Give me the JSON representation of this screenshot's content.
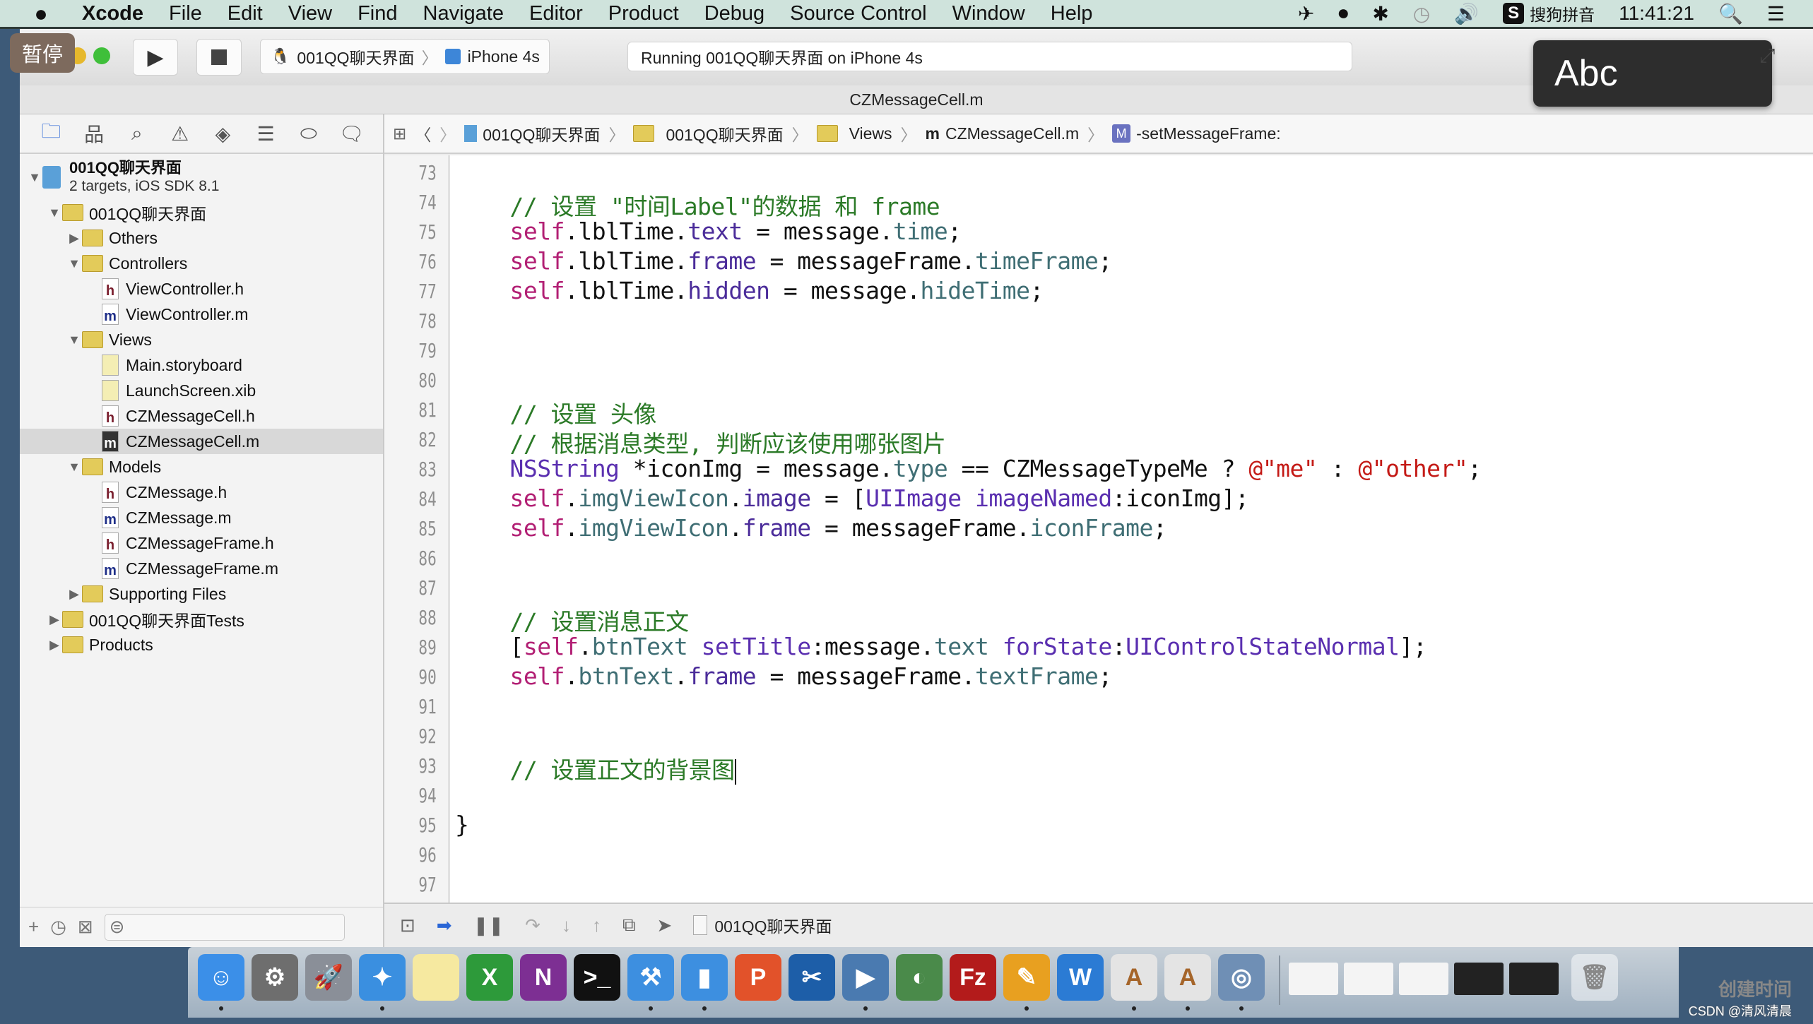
{
  "menubar": {
    "apple": "",
    "app_name": "Xcode",
    "items": [
      "File",
      "Edit",
      "View",
      "Find",
      "Navigate",
      "Editor",
      "Product",
      "Debug",
      "Source Control",
      "Window",
      "Help"
    ],
    "input_method": "搜狗拼音",
    "input_method_badge": "S",
    "clock": "11:41:21"
  },
  "toolbar": {
    "pause_badge": "暂停",
    "scheme": "001QQ聊天界面",
    "device": "iPhone 4s",
    "activity": "Running 001QQ聊天界面 on iPhone 4s",
    "ime_hud": "Abc"
  },
  "tab_title": "CZMessageCell.m",
  "navigator": {
    "project": {
      "name": "001QQ聊天界面",
      "subtitle": "2 targets, iOS SDK 8.1"
    },
    "tree": [
      {
        "label": "001QQ聊天界面",
        "type": "folder",
        "level": 1,
        "open": true
      },
      {
        "label": "Others",
        "type": "folder",
        "level": 2,
        "open": false
      },
      {
        "label": "Controllers",
        "type": "folder",
        "level": 2,
        "open": true
      },
      {
        "label": "ViewController.h",
        "type": "h",
        "level": 3
      },
      {
        "label": "ViewController.m",
        "type": "m",
        "level": 3
      },
      {
        "label": "Views",
        "type": "folder",
        "level": 2,
        "open": true
      },
      {
        "label": "Main.storyboard",
        "type": "sb",
        "level": 3
      },
      {
        "label": "LaunchScreen.xib",
        "type": "xib",
        "level": 3
      },
      {
        "label": "CZMessageCell.h",
        "type": "h",
        "level": 3
      },
      {
        "label": "CZMessageCell.m",
        "type": "m",
        "level": 3,
        "selected": true
      },
      {
        "label": "Models",
        "type": "folder",
        "level": 2,
        "open": true
      },
      {
        "label": "CZMessage.h",
        "type": "h",
        "level": 3
      },
      {
        "label": "CZMessage.m",
        "type": "m",
        "level": 3
      },
      {
        "label": "CZMessageFrame.h",
        "type": "h",
        "level": 3
      },
      {
        "label": "CZMessageFrame.m",
        "type": "m",
        "level": 3
      },
      {
        "label": "Supporting Files",
        "type": "folder",
        "level": 2,
        "open": false
      },
      {
        "label": "001QQ聊天界面Tests",
        "type": "folder",
        "level": 1,
        "open": false
      },
      {
        "label": "Products",
        "type": "folder",
        "level": 1,
        "open": false
      }
    ],
    "tabs": [
      "project-navigator-icon",
      "symbol-navigator-icon",
      "find-navigator-icon",
      "issue-navigator-icon",
      "test-navigator-icon",
      "debug-navigator-icon",
      "breakpoint-navigator-icon",
      "report-navigator-icon"
    ]
  },
  "jumpbar": {
    "crumbs": [
      "001QQ聊天界面",
      "001QQ聊天界面",
      "Views",
      "CZMessageCell.m",
      "-setMessageFrame:"
    ],
    "method_badge": "M"
  },
  "editor": {
    "lines": [
      {
        "n": "73",
        "html": ""
      },
      {
        "n": "74",
        "html": "    <span class='c-com'>// 设置 \"时间Label\"的数据 和 frame</span>"
      },
      {
        "n": "75",
        "html": "    <span class='c-kw'>self</span>.lblTime.<span class='c-prop'>text</span> = message.<span class='c-mem'>time</span>;"
      },
      {
        "n": "76",
        "html": "    <span class='c-kw'>self</span>.lblTime.<span class='c-prop'>frame</span> = messageFrame.<span class='c-mem'>timeFrame</span>;"
      },
      {
        "n": "77",
        "html": "    <span class='c-kw'>self</span>.lblTime.<span class='c-prop'>hidden</span> = message.<span class='c-mem'>hideTime</span>;"
      },
      {
        "n": "78",
        "html": ""
      },
      {
        "n": "79",
        "html": ""
      },
      {
        "n": "80",
        "html": ""
      },
      {
        "n": "81",
        "html": "    <span class='c-com'>// 设置 头像</span>"
      },
      {
        "n": "82",
        "html": "    <span class='c-com'>// 根据消息类型, 判断应该使用哪张图片</span>"
      },
      {
        "n": "83",
        "html": "    <span class='c-cls'>NSString</span> *iconImg = message.<span class='c-mem'>type</span> == CZMessageTypeMe ? <span class='c-str'>@\"me\"</span> : <span class='c-str'>@\"other\"</span>;"
      },
      {
        "n": "84",
        "html": "    <span class='c-kw'>self</span>.<span class='c-mem'>imgViewIcon</span>.<span class='c-prop'>image</span> = [<span class='c-cls'>UIImage</span> <span class='c-cls'>imageNamed</span>:iconImg];"
      },
      {
        "n": "85",
        "html": "    <span class='c-kw'>self</span>.<span class='c-mem'>imgViewIcon</span>.<span class='c-prop'>frame</span> = messageFrame.<span class='c-mem'>iconFrame</span>;"
      },
      {
        "n": "86",
        "html": ""
      },
      {
        "n": "87",
        "html": ""
      },
      {
        "n": "88",
        "html": "    <span class='c-com'>// 设置消息正文</span>"
      },
      {
        "n": "89",
        "html": "    [<span class='c-kw'>self</span>.<span class='c-mem'>btnText</span> <span class='c-cls'>setTitle</span>:message.<span class='c-mem'>text</span> <span class='c-cls'>forState</span>:<span class='c-cls'>UIControlStateNormal</span>];"
      },
      {
        "n": "90",
        "html": "    <span class='c-kw'>self</span>.<span class='c-mem'>btnText</span>.<span class='c-prop'>frame</span> = messageFrame.<span class='c-mem'>textFrame</span>;"
      },
      {
        "n": "91",
        "html": ""
      },
      {
        "n": "92",
        "html": ""
      },
      {
        "n": "93",
        "html": "    <span class='c-com'>// 设置正文的背景图</span><span class='caret'></span>"
      },
      {
        "n": "94",
        "html": ""
      },
      {
        "n": "95",
        "html": "}"
      },
      {
        "n": "96",
        "html": ""
      },
      {
        "n": "97",
        "html": ""
      }
    ]
  },
  "debugbar": {
    "target": "001QQ聊天界面"
  },
  "annotation": {
    "arrow_color": "#e8332a"
  },
  "dock": {
    "apps": [
      {
        "name": "finder",
        "glyph": "☺",
        "color": "#3b8fe8",
        "running": true
      },
      {
        "name": "system-preferences",
        "glyph": "⚙",
        "color": "#6e6e6e",
        "running": false
      },
      {
        "name": "launchpad",
        "glyph": "🚀",
        "color": "#8a8f98",
        "running": false
      },
      {
        "name": "safari",
        "glyph": "✦",
        "color": "#3a8fe0",
        "running": true
      },
      {
        "name": "notes",
        "glyph": "",
        "color": "#f6e9a0",
        "running": false
      },
      {
        "name": "excel",
        "glyph": "X",
        "color": "#2d9a3a",
        "running": false
      },
      {
        "name": "onenote",
        "glyph": "N",
        "color": "#7d2f93",
        "running": false
      },
      {
        "name": "terminal",
        "glyph": ">_",
        "color": "#111111",
        "running": false
      },
      {
        "name": "xcode",
        "glyph": "⚒",
        "color": "#3d8fe0",
        "running": true
      },
      {
        "name": "simulator",
        "glyph": "▮",
        "color": "#3d8fe0",
        "running": true
      },
      {
        "name": "powerpoint",
        "glyph": "P",
        "color": "#e2522a",
        "running": false
      },
      {
        "name": "screenshot-tool",
        "glyph": "✂",
        "color": "#1d5ea8",
        "running": false
      },
      {
        "name": "video-app",
        "glyph": "▶",
        "color": "#4a7ab0",
        "running": true
      },
      {
        "name": "time-machine",
        "glyph": "◐",
        "color": "#4a8a4a",
        "running": false
      },
      {
        "name": "filezilla",
        "glyph": "Fz",
        "color": "#b31b1b",
        "running": false
      },
      {
        "name": "sketch-tool",
        "glyph": "✎",
        "color": "#e8a020",
        "running": true
      },
      {
        "name": "word",
        "glyph": "W",
        "color": "#2b7bd4",
        "running": false
      },
      {
        "name": "textedit-1",
        "glyph": "A",
        "color": "#e4e4e4",
        "running": true
      },
      {
        "name": "textedit-2",
        "glyph": "A",
        "color": "#e4e4e4",
        "running": true
      },
      {
        "name": "preview",
        "glyph": "◎",
        "color": "#6f8fb5",
        "running": true
      }
    ],
    "stacks": [
      "doc-stack-1",
      "doc-stack-2",
      "doc-stack-3",
      "screen-stack-1",
      "screen-stack-2"
    ],
    "trash": "trash"
  },
  "watermark": {
    "line1": "创建时间",
    "line2": "CSDN @清风清晨"
  }
}
